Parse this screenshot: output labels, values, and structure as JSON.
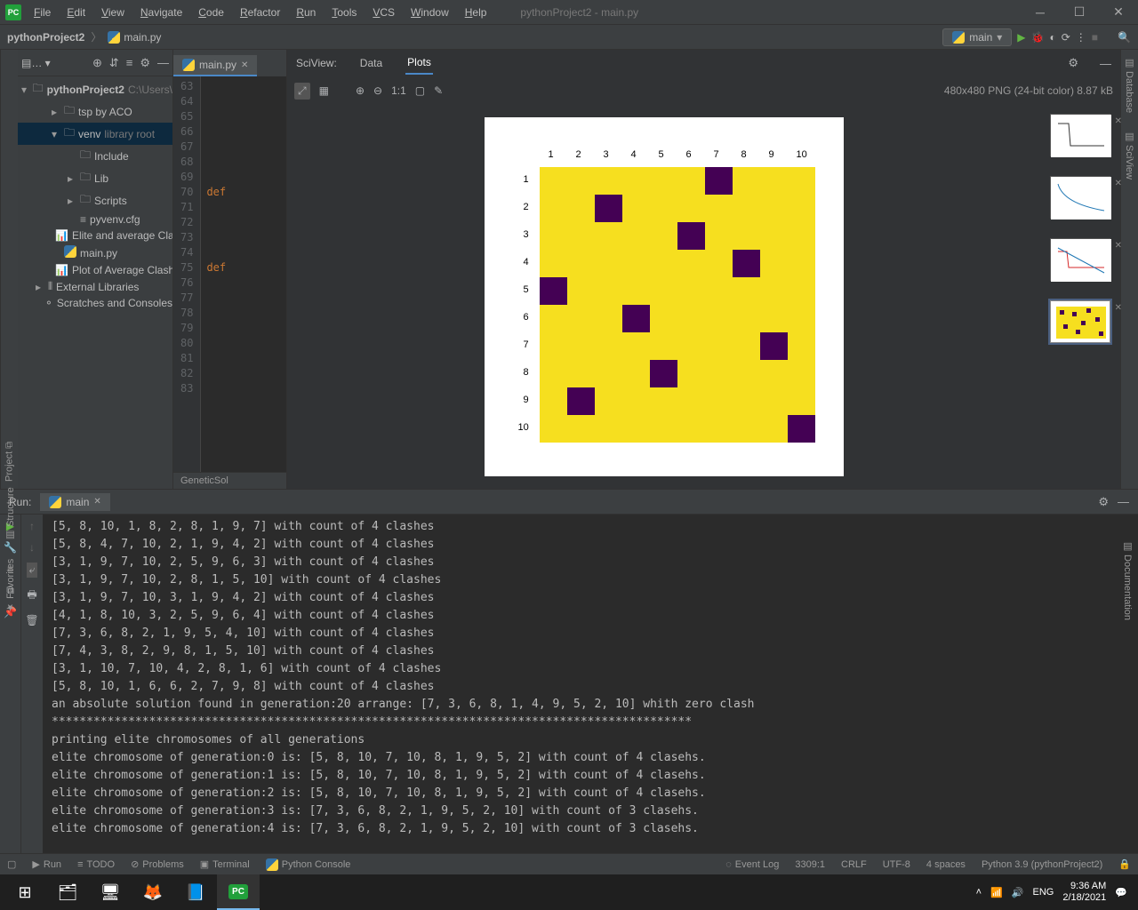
{
  "window": {
    "title": "pythonProject2 - main.py"
  },
  "menu": [
    "File",
    "Edit",
    "View",
    "Navigate",
    "Code",
    "Refactor",
    "Run",
    "Tools",
    "VCS",
    "Window",
    "Help"
  ],
  "breadcrumb": {
    "project": "pythonProject2",
    "file": "main.py"
  },
  "run_config": {
    "name": "main"
  },
  "project_tree": {
    "root": "pythonProject2",
    "root_path": "C:\\Users\\",
    "items": [
      {
        "t": "chev-right",
        "label": "tsp by ACO",
        "indent": 1,
        "icon": "folder"
      },
      {
        "t": "chev-down",
        "label": "venv",
        "hint": "library root",
        "indent": 1,
        "icon": "folder",
        "sel": true
      },
      {
        "t": "",
        "label": "Include",
        "indent": 2,
        "icon": "folder"
      },
      {
        "t": "chev-right",
        "label": "Lib",
        "indent": 2,
        "icon": "folder"
      },
      {
        "t": "chev-right",
        "label": "Scripts",
        "indent": 2,
        "icon": "folder"
      },
      {
        "t": "",
        "label": "pyvenv.cfg",
        "indent": 2,
        "icon": "file"
      },
      {
        "t": "",
        "label": "Elite and average Clash",
        "indent": 1,
        "icon": "chart"
      },
      {
        "t": "",
        "label": "main.py",
        "indent": 1,
        "icon": "py"
      },
      {
        "t": "",
        "label": "Plot of Average Clashes",
        "indent": 1,
        "icon": "chart"
      },
      {
        "t": "chev-right",
        "label": "External Libraries",
        "indent": 0,
        "icon": "lib"
      },
      {
        "t": "",
        "label": "Scratches and Consoles",
        "indent": 0,
        "icon": "scratch"
      }
    ]
  },
  "editor": {
    "tab": "main.py",
    "start_line": 63,
    "def_lines": [
      70,
      75
    ],
    "bottom_label": "GeneticSol"
  },
  "sciview": {
    "label": "SciView:",
    "tabs": [
      "Data",
      "Plots"
    ],
    "active": 1,
    "info": "480x480 PNG (24-bit color) 8.87 kB",
    "ratio": "1:1"
  },
  "chart_data": {
    "type": "heatmap",
    "title": "",
    "x_ticks": [
      1,
      2,
      3,
      4,
      5,
      6,
      7,
      8,
      9,
      10
    ],
    "y_ticks": [
      1,
      2,
      3,
      4,
      5,
      6,
      7,
      8,
      9,
      10
    ],
    "background_color": "#f6df1f",
    "mark_color": "#440154",
    "points": [
      {
        "col": 7,
        "row": 1
      },
      {
        "col": 3,
        "row": 2
      },
      {
        "col": 6,
        "row": 3
      },
      {
        "col": 8,
        "row": 4
      },
      {
        "col": 1,
        "row": 5
      },
      {
        "col": 4,
        "row": 6
      },
      {
        "col": 9,
        "row": 7
      },
      {
        "col": 5,
        "row": 8
      },
      {
        "col": 2,
        "row": 9
      },
      {
        "col": 10,
        "row": 10
      }
    ]
  },
  "run_panel": {
    "title": "Run:",
    "tab": "main",
    "lines": [
      "[5, 8, 10, 1, 8, 2, 8, 1, 9, 7] with count of 4 clashes",
      "[5, 8, 4, 7, 10, 2, 1, 9, 4, 2] with count of 4 clashes",
      "[3, 1, 9, 7, 10, 2, 5, 9, 6, 3] with count of 4 clashes",
      "[3, 1, 9, 7, 10, 2, 8, 1, 5, 10] with count of 4 clashes",
      "[3, 1, 9, 7, 10, 3, 1, 9, 4, 2] with count of 4 clashes",
      "[4, 1, 8, 10, 3, 2, 5, 9, 6, 4] with count of 4 clashes",
      "[7, 3, 6, 8, 2, 1, 9, 5, 4, 10] with count of 4 clashes",
      "[7, 4, 3, 8, 2, 9, 8, 1, 5, 10] with count of 4 clashes",
      "[3, 1, 10, 7, 10, 4, 2, 8, 1, 6] with count of 4 clashes",
      "[5, 8, 10, 1, 6, 6, 2, 7, 9, 8] with count of 4 clashes",
      "an absolute solution found in generation:20 arrange: [7, 3, 6, 8, 1, 4, 9, 5, 2, 10] whith zero clash",
      "********************************************************************************************",
      "printing elite chromosomes of all generations",
      "elite chromosome of generation:0 is: [5, 8, 10, 7, 10, 8, 1, 9, 5, 2] with count of 4 clasehs.",
      "elite chromosome of generation:1 is: [5, 8, 10, 7, 10, 8, 1, 9, 5, 2] with count of 4 clasehs.",
      "elite chromosome of generation:2 is: [5, 8, 10, 7, 10, 8, 1, 9, 5, 2] with count of 4 clasehs.",
      "elite chromosome of generation:3 is: [7, 3, 6, 8, 2, 1, 9, 5, 2, 10] with count of 3 clasehs.",
      "elite chromosome of generation:4 is: [7, 3, 6, 8, 2, 1, 9, 5, 2, 10] with count of 3 clasehs."
    ]
  },
  "statusbar": {
    "run": "Run",
    "todo": "TODO",
    "problems": "Problems",
    "terminal": "Terminal",
    "py_console": "Python Console",
    "event_log": "Event Log",
    "pos": "3309:1",
    "eol": "CRLF",
    "enc": "UTF-8",
    "indent": "4 spaces",
    "sdk": "Python 3.9 (pythonProject2)"
  },
  "taskbar": {
    "time": "9:36 AM",
    "date": "2/18/2021",
    "lang": "ENG"
  }
}
